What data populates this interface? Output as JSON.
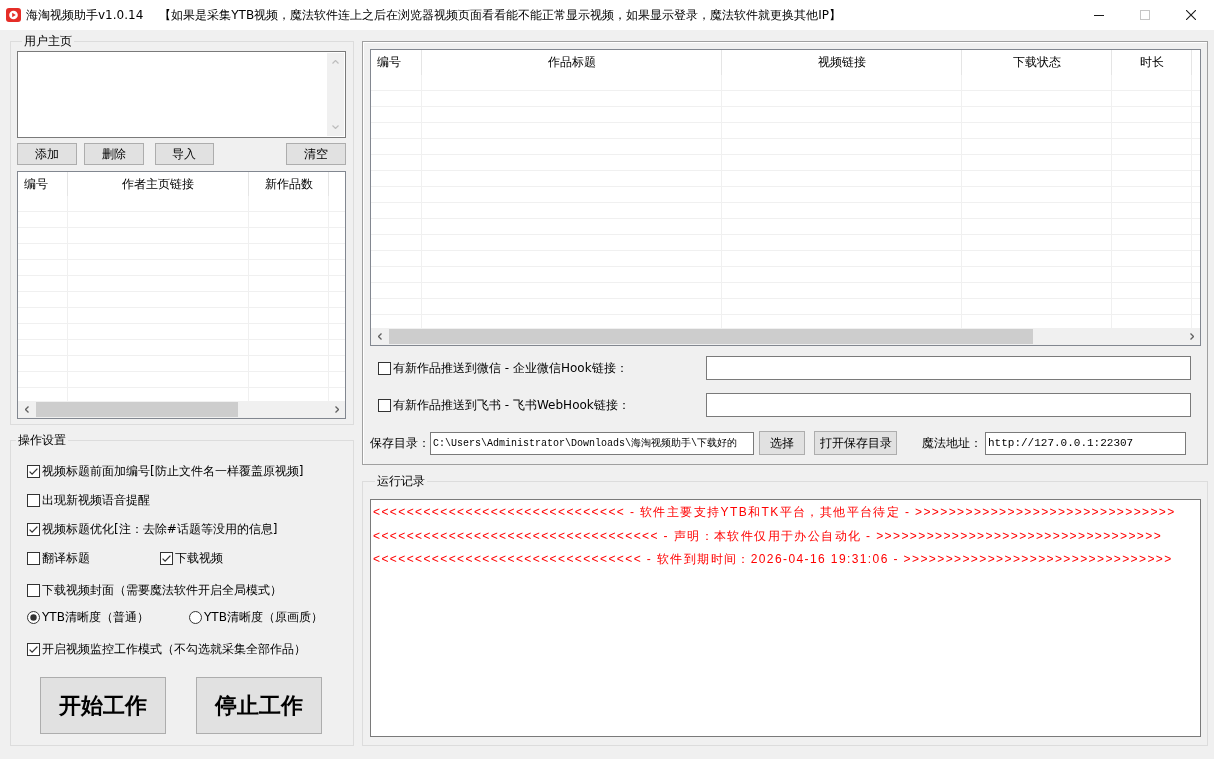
{
  "window": {
    "title": "海淘视频助手v1.0.14",
    "notice": "【如果是采集YTB视频，魔法软件连上之后在浏览器视频页面看看能不能正常显示视频，如果显示登录，魔法软件就更换其他IP】",
    "controls": [
      {
        "kind": "minimize",
        "disabled": false
      },
      {
        "kind": "maximize",
        "disabled": true
      },
      {
        "kind": "close",
        "disabled": false
      }
    ]
  },
  "user_homepage": {
    "title": "用户主页",
    "buttons": [
      "添加",
      "删除",
      "导入",
      "清空"
    ],
    "table": {
      "columns": [
        "编号",
        "作者主页链接",
        "新作品数"
      ]
    }
  },
  "settings": {
    "title": "操作设置",
    "options": [
      [
        {
          "kind": "checkbox",
          "label": "视频标题前面加编号[防止文件名一样覆盖原视频]",
          "checked": true
        }
      ],
      [
        {
          "kind": "checkbox",
          "label": "出现新视频语音提醒",
          "checked": false
        }
      ],
      [
        {
          "kind": "checkbox",
          "label": "视频标题优化[注：去除#话题等没用的信息]",
          "checked": true
        }
      ],
      [
        {
          "kind": "checkbox",
          "label": "翻译标题",
          "checked": false
        },
        {
          "kind": "checkbox",
          "label": "下载视频",
          "checked": true
        }
      ],
      [
        {
          "kind": "checkbox",
          "label": "下载视频封面（需要魔法软件开启全局模式）",
          "checked": false
        }
      ],
      [
        {
          "kind": "radio",
          "label": "YTB清晰度（普通）",
          "selected": true
        },
        {
          "kind": "radio",
          "label": "YTB清晰度（原画质）",
          "selected": false
        }
      ],
      [
        {
          "kind": "checkbox",
          "label": "开启视频监控工作模式（不勾选就采集全部作品）",
          "checked": true
        }
      ]
    ],
    "buttons": [
      "开始工作",
      "停止工作"
    ]
  },
  "works": {
    "table": {
      "columns": [
        "编号",
        "作品标题",
        "视频链接",
        "下载状态",
        "时长"
      ]
    },
    "push": [
      {
        "label": "有新作品推送到微信 - 企业微信Hook链接：",
        "checked": false
      },
      {
        "label": "有新作品推送到飞书 - 飞书WebHook链接：",
        "checked": false
      }
    ],
    "save_dir": {
      "label": "保存目录：",
      "value": "C:\\Users\\Administrator\\Downloads\\海淘视频助手\\下载好的"
    },
    "buttons": [
      "选择",
      "打开保存目录"
    ],
    "proxy": {
      "label": "魔法地址：",
      "value": "http://127.0.0.1:22307"
    }
  },
  "log": {
    "title": "运行记录",
    "lines": [
      "<<<<<<<<<<<<<<<<<<<<<<<<<<<<<< - 软件主要支持YTB和TK平台，其他平台待定 - >>>>>>>>>>>>>>>>>>>>>>>>>>>>>>>",
      "<<<<<<<<<<<<<<<<<<<<<<<<<<<<<<<<<< - 声明：本软件仅用于办公自动化 - >>>>>>>>>>>>>>>>>>>>>>>>>>>>>>>>>>",
      "<<<<<<<<<<<<<<<<<<<<<<<<<<<<<<<< - 软件到期时间：2026-04-16 19:31:06 - >>>>>>>>>>>>>>>>>>>>>>>>>>>>>>>>"
    ]
  }
}
